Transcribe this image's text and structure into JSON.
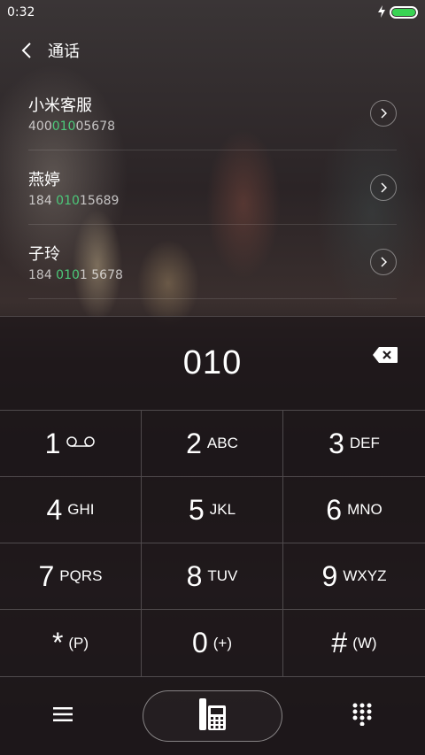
{
  "status_bar": {
    "time": "0:32",
    "battery_level": 1.0,
    "charging_icon": "bolt-icon"
  },
  "header": {
    "title": "通话",
    "back_icon": "chevron-left-icon"
  },
  "results": [
    {
      "name": "小米客服",
      "number_pre": "400",
      "number_match": "010",
      "number_post": "05678"
    },
    {
      "name": "燕婷",
      "number_pre": "184 ",
      "number_match": "010",
      "number_post": "15689"
    },
    {
      "name": "子玲",
      "number_pre": "184 ",
      "number_match": "010",
      "number_post": "1 5678"
    }
  ],
  "colors": {
    "match_highlight": "#4cc97a",
    "battery": "#39d353"
  },
  "dialer": {
    "digits": "010",
    "backspace_icon": "backspace-icon"
  },
  "keypad": [
    {
      "digit": "1",
      "letters": "",
      "icon": "voicemail-icon"
    },
    {
      "digit": "2",
      "letters": "ABC"
    },
    {
      "digit": "3",
      "letters": "DEF"
    },
    {
      "digit": "4",
      "letters": "GHI"
    },
    {
      "digit": "5",
      "letters": "JKL"
    },
    {
      "digit": "6",
      "letters": "MNO"
    },
    {
      "digit": "7",
      "letters": "PQRS"
    },
    {
      "digit": "8",
      "letters": "TUV"
    },
    {
      "digit": "9",
      "letters": "WXYZ"
    },
    {
      "digit": "*",
      "letters": "(P)"
    },
    {
      "digit": "0",
      "letters": "(+)"
    },
    {
      "digit": "#",
      "letters": "(W)"
    }
  ],
  "bottom_bar": {
    "menu_icon": "menu-icon",
    "call_icon": "phone-icon",
    "keypad_icon": "dialpad-icon"
  }
}
